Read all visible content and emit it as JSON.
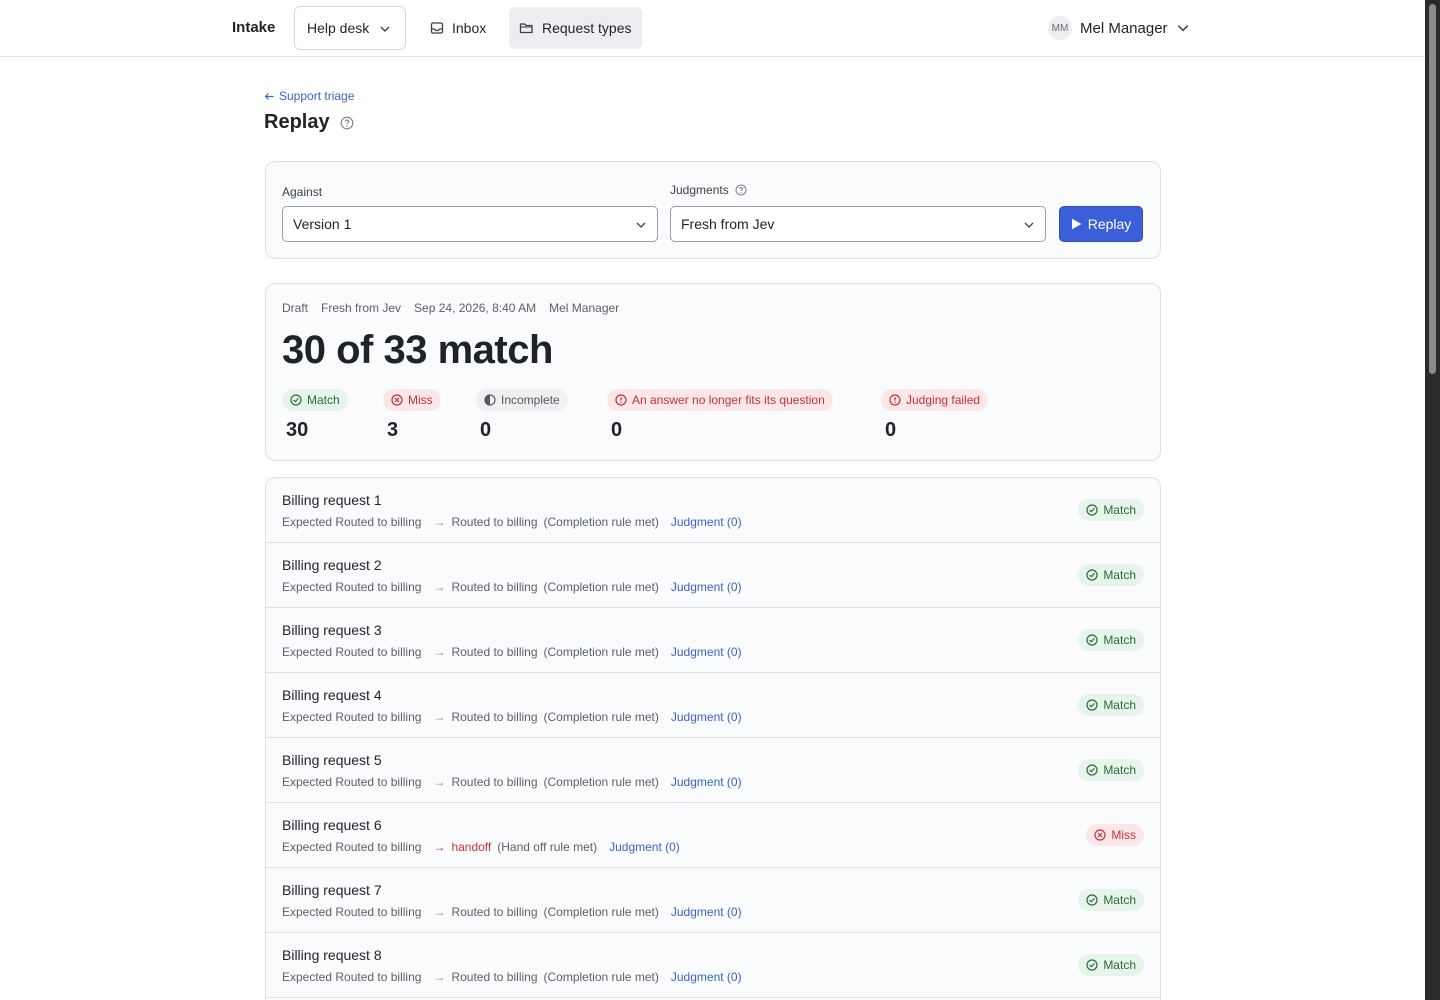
{
  "app": {
    "brand": "Intake",
    "workspace": "Help desk",
    "nav": [
      {
        "label": "Inbox",
        "icon": "inbox-icon"
      },
      {
        "label": "Request types",
        "icon": "folder-icon"
      }
    ],
    "user": {
      "initials": "MM",
      "name": "Mel Manager"
    }
  },
  "page": {
    "back_label": "Support triage",
    "title": "Replay"
  },
  "filters": {
    "against_label": "Against",
    "against_value": "Version 1",
    "judgments_label": "Judgments",
    "judgments_value": "Fresh from Jev",
    "replay_button": "Replay"
  },
  "summary": {
    "meta": [
      "Draft",
      "Fresh from Jev",
      "Sep 24, 2026, 8:40 AM",
      "Mel Manager"
    ],
    "headline": "30 of 33 match",
    "stats": [
      {
        "label": "Match",
        "value": "30",
        "kind": "match"
      },
      {
        "label": "Miss",
        "value": "3",
        "kind": "miss"
      },
      {
        "label": "Incomplete",
        "value": "0",
        "kind": "incomplete"
      },
      {
        "label": "An answer no longer fits its question",
        "value": "0",
        "kind": "miss"
      },
      {
        "label": "Judging failed",
        "value": "0",
        "kind": "miss"
      }
    ]
  },
  "rows": [
    {
      "title": "Billing request 1",
      "expected": "Expected Routed to billing",
      "outcome": "Routed to billing",
      "reason": "(Completion rule met)",
      "judgment": "Judgment (0)",
      "status": "Match",
      "kind": "match"
    },
    {
      "title": "Billing request 2",
      "expected": "Expected Routed to billing",
      "outcome": "Routed to billing",
      "reason": "(Completion rule met)",
      "judgment": "Judgment (0)",
      "status": "Match",
      "kind": "match"
    },
    {
      "title": "Billing request 3",
      "expected": "Expected Routed to billing",
      "outcome": "Routed to billing",
      "reason": "(Completion rule met)",
      "judgment": "Judgment (0)",
      "status": "Match",
      "kind": "match"
    },
    {
      "title": "Billing request 4",
      "expected": "Expected Routed to billing",
      "outcome": "Routed to billing",
      "reason": "(Completion rule met)",
      "judgment": "Judgment (0)",
      "status": "Match",
      "kind": "match"
    },
    {
      "title": "Billing request 5",
      "expected": "Expected Routed to billing",
      "outcome": "Routed to billing",
      "reason": "(Completion rule met)",
      "judgment": "Judgment (0)",
      "status": "Match",
      "kind": "match"
    },
    {
      "title": "Billing request 6",
      "expected": "Expected Routed to billing",
      "outcome": "handoff",
      "reason": "(Hand off rule met)",
      "judgment": "Judgment (0)",
      "status": "Miss",
      "kind": "miss"
    },
    {
      "title": "Billing request 7",
      "expected": "Expected Routed to billing",
      "outcome": "Routed to billing",
      "reason": "(Completion rule met)",
      "judgment": "Judgment (0)",
      "status": "Match",
      "kind": "match"
    },
    {
      "title": "Billing request 8",
      "expected": "Expected Routed to billing",
      "outcome": "Routed to billing",
      "reason": "(Completion rule met)",
      "judgment": "Judgment (0)",
      "status": "Match",
      "kind": "match"
    }
  ],
  "colors": {
    "accent": "#3a5fd8",
    "match_bg": "#e6f4ea",
    "match_fg": "#2d6b3a",
    "miss_bg": "#fbe7e7",
    "miss_fg": "#c4323b",
    "link": "#3a63c6"
  }
}
